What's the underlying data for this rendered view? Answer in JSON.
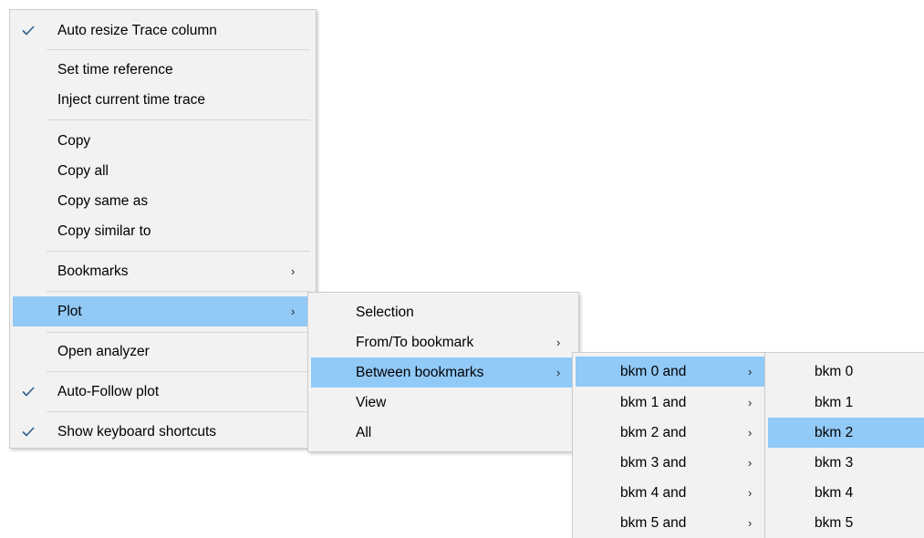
{
  "main_menu": {
    "items": [
      {
        "label": "Auto resize Trace column",
        "checked": true
      },
      {
        "label": "Set time reference"
      },
      {
        "label": "Inject current time trace"
      },
      {
        "label": "Copy"
      },
      {
        "label": "Copy all"
      },
      {
        "label": "Copy same as"
      },
      {
        "label": "Copy similar to"
      },
      {
        "label": "Bookmarks",
        "submenu": true
      },
      {
        "label": "Plot",
        "submenu": true,
        "highlighted": true
      },
      {
        "label": "Open analyzer"
      },
      {
        "label": "Auto-Follow plot",
        "checked": true
      },
      {
        "label": "Show keyboard shortcuts",
        "checked": true
      }
    ]
  },
  "plot_menu": {
    "items": [
      {
        "label": "Selection"
      },
      {
        "label": "From/To bookmark",
        "submenu": true
      },
      {
        "label": "Between bookmarks",
        "submenu": true,
        "highlighted": true
      },
      {
        "label": "View"
      },
      {
        "label": "All"
      }
    ]
  },
  "between_menu": {
    "items": [
      {
        "label": "bkm 0 and",
        "submenu": true,
        "highlighted": true
      },
      {
        "label": "bkm 1 and",
        "submenu": true
      },
      {
        "label": "bkm 2 and",
        "submenu": true
      },
      {
        "label": "bkm 3 and",
        "submenu": true
      },
      {
        "label": "bkm 4 and",
        "submenu": true
      },
      {
        "label": "bkm 5 and",
        "submenu": true
      }
    ]
  },
  "bkm0_menu": {
    "items": [
      {
        "label": "bkm 0"
      },
      {
        "label": "bkm 1"
      },
      {
        "label": "bkm 2",
        "highlighted": true
      },
      {
        "label": "bkm 3"
      },
      {
        "label": "bkm 4"
      },
      {
        "label": "bkm 5"
      }
    ]
  },
  "glyphs": {
    "submenu_arrow": "›"
  },
  "colors": {
    "highlight": "#91c9f7",
    "menu_bg": "#f2f2f2"
  }
}
